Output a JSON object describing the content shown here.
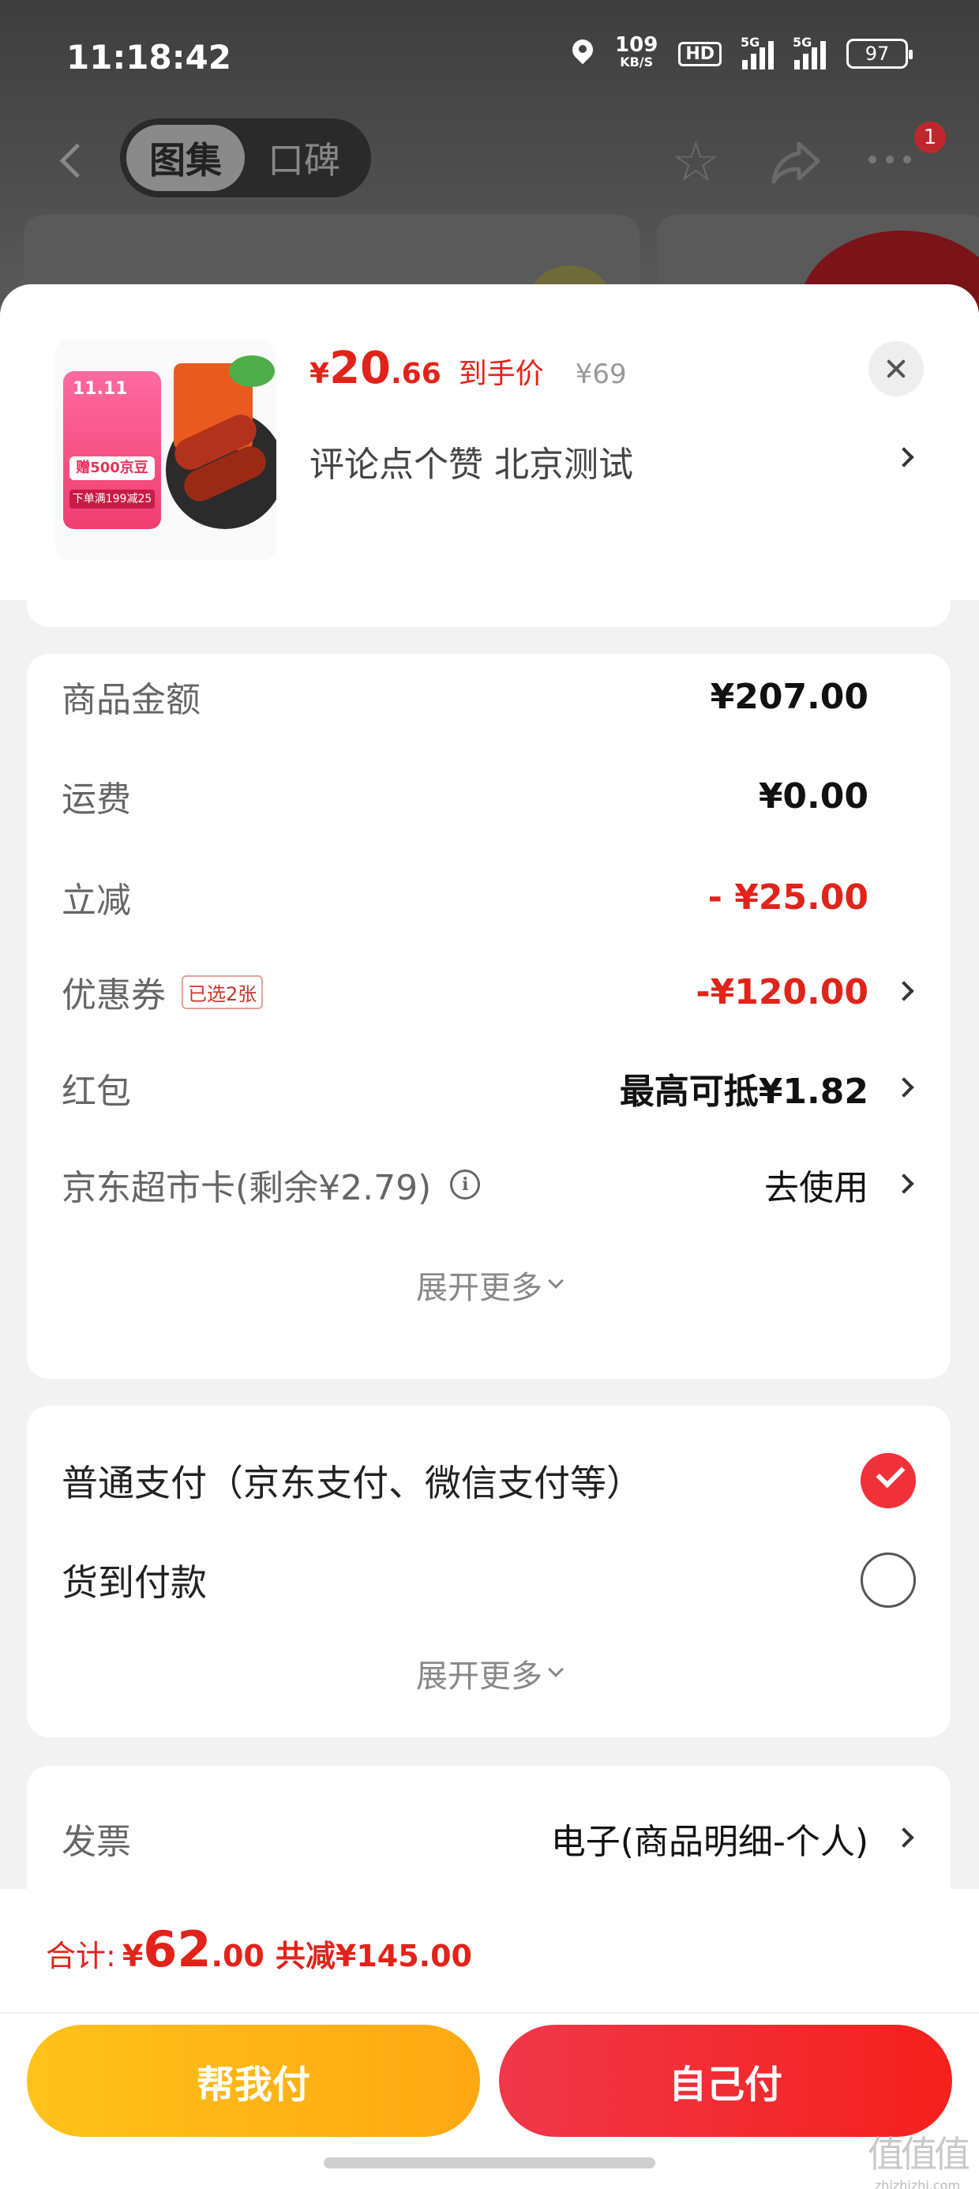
{
  "status_bar": {
    "time": "11:18:42",
    "net_speed": "109",
    "net_unit": "KB/S",
    "hd_label": "HD",
    "signal1_label": "5G",
    "signal2_label": "5G",
    "battery": "97"
  },
  "top_nav": {
    "tabs": [
      {
        "label": "图集",
        "active": true
      },
      {
        "label": "口碑",
        "active": false
      }
    ],
    "notification_count": "1"
  },
  "product": {
    "price_currency": "¥",
    "price_integer": "20",
    "price_decimal": ".66",
    "price_label": "到手价",
    "original_price": "¥69",
    "spec": "评论点个赞  北京测试",
    "promo_title": "11.11",
    "promo_gift": "赠500京豆",
    "promo_deal": "下单满199减25"
  },
  "fees": {
    "rows": [
      {
        "label": "商品金额",
        "value": "¥207.00"
      },
      {
        "label": "运费",
        "value": "¥0.00"
      },
      {
        "label": "立减",
        "value": "- ¥25.00"
      },
      {
        "label": "优惠券",
        "tag": "已选2张",
        "value": "-¥120.00"
      },
      {
        "label": "红包",
        "value": "最高可抵¥1.82"
      },
      {
        "label": "京东超市卡(剩余¥2.79)",
        "value": "去使用"
      }
    ],
    "expand_label": "展开更多"
  },
  "payment": {
    "options": [
      {
        "label": "普通支付（京东支付、微信支付等）",
        "selected": true
      },
      {
        "label": "货到付款",
        "selected": false
      }
    ],
    "expand_label": "展开更多"
  },
  "invoice": {
    "label": "发票",
    "value": "电子(商品明细-个人)"
  },
  "footer": {
    "total_label": "合计:",
    "total_currency": "¥",
    "total_integer": "62",
    "total_decimal": ".00",
    "total_saving": "共减¥145.00",
    "help_pay_label": "帮我付",
    "self_pay_label": "自己付"
  },
  "watermark": {
    "text": "值值值",
    "site": "zhizhizhi.com"
  },
  "colors": {
    "accent_red": "#e2231a",
    "help_button": "#ffb416",
    "self_button": "#f22a2e"
  }
}
